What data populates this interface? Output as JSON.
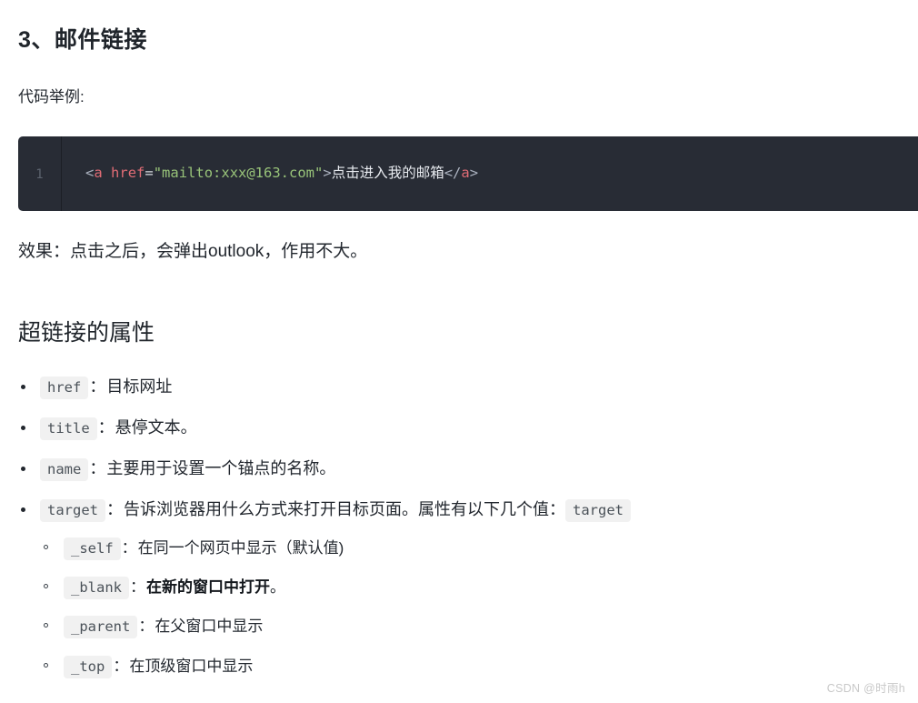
{
  "document": {
    "heading_numbered": "3、邮件链接",
    "code_example_label": "代码举例:",
    "effect_paragraph": "效果：点击之后，会弹出outlook，作用不大。",
    "section_heading": "超链接的属性"
  },
  "code_block": {
    "line_number": "1",
    "language": "html",
    "tokens": {
      "open_bracket": "<",
      "tag_name": "a",
      "space": " ",
      "attr_name": "href",
      "equals": "=",
      "attr_value": "\"mailto:xxx@163.com\"",
      "close_bracket": ">",
      "link_text": "点击进入我的邮箱",
      "close_tag_open": "</",
      "close_tag_name": "a",
      "close_tag_end": ">"
    },
    "full_text": "<a href=\"mailto:xxx@163.com\">点击进入我的邮箱</a>",
    "colors": {
      "background": "#282c35",
      "tag": "#e06c75",
      "attribute": "#e06c75",
      "string": "#98c379",
      "punctuation": "#abb2bf",
      "text": "#e8ebf0",
      "line_number": "#5c636e",
      "scroll_marker": "#3e8fc4"
    }
  },
  "attributes": [
    {
      "code": "href",
      "separator": "：",
      "description": "目标网址",
      "bold": false
    },
    {
      "code": "title",
      "separator": "：",
      "description": "悬停文本。",
      "bold": false
    },
    {
      "code": "name",
      "separator": "：",
      "description": "主要用于设置一个锚点的名称。",
      "bold": false
    },
    {
      "code": "target",
      "separator": "：",
      "description": "告诉浏览器用什么方式来打开目标页面。属性有以下几个值：",
      "trailing_code": "target",
      "bold": false,
      "sub_items": [
        {
          "code": "_self",
          "separator": "：",
          "description": "在同一个网页中显示（默认值)",
          "bold": false
        },
        {
          "code": "_blank",
          "separator": "：",
          "description": "在新的窗口中打开",
          "suffix": "。",
          "bold": true
        },
        {
          "code": "_parent",
          "separator": "：",
          "description": "在父窗口中显示",
          "bold": false
        },
        {
          "code": "_top",
          "separator": "：",
          "description": "在顶级窗口中显示",
          "bold": false
        }
      ]
    }
  ],
  "watermark": {
    "text": "CSDN @时雨h",
    "color": "#c8c8c8"
  }
}
